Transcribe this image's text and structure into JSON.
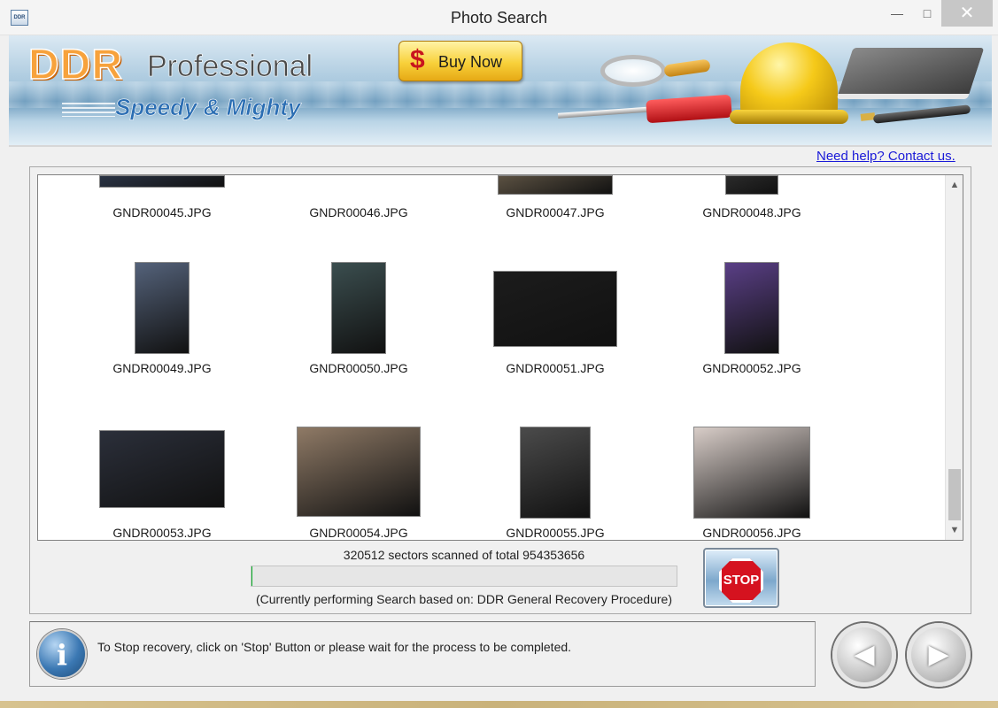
{
  "window": {
    "title": "Photo Search",
    "icon_text": "DDR",
    "minimize_icon": "minimize-icon",
    "maximize_icon": "maximize-icon",
    "close_icon": "close-icon"
  },
  "banner": {
    "brand": "DDR",
    "product": "Professional",
    "tagline": "Speedy & Mighty",
    "buy_symbol": "$",
    "buy_label": "Buy Now"
  },
  "help_link": "Need help? Contact us.",
  "gallery": {
    "items": [
      {
        "name": "GNDR00045.JPG",
        "color": "#2a3344"
      },
      {
        "name": "GNDR00046.JPG",
        "color": "#ffffff"
      },
      {
        "name": "GNDR00047.JPG",
        "color": "#5b5142"
      },
      {
        "name": "GNDR00048.JPG",
        "color": "#2b2b2b"
      },
      {
        "name": "GNDR00049.JPG",
        "color": "#54627a"
      },
      {
        "name": "GNDR00050.JPG",
        "color": "#3b4e4f"
      },
      {
        "name": "GNDR00051.JPG",
        "color": "#1c1c1c"
      },
      {
        "name": "GNDR00052.JPG",
        "color": "#5a3f86"
      },
      {
        "name": "GNDR00053.JPG",
        "color": "#2b2f3a"
      },
      {
        "name": "GNDR00054.JPG",
        "color": "#8f7a66"
      },
      {
        "name": "GNDR00055.JPG",
        "color": "#4b4b4b"
      },
      {
        "name": "GNDR00056.JPG",
        "color": "#d8cdc8"
      }
    ]
  },
  "progress": {
    "text": "320512 sectors scanned of total 954353656",
    "sectors_scanned": 320512,
    "sectors_total": 954353656,
    "procedure": "(Currently performing Search based on:  DDR General Recovery Procedure)"
  },
  "stop_button": {
    "label": "STOP"
  },
  "info": {
    "icon": "info-icon",
    "glyph": "i",
    "message": "To Stop recovery, click on 'Stop' Button or please wait for the process to be completed."
  },
  "nav": {
    "back_glyph": "◀",
    "next_glyph": "▶"
  },
  "colors": {
    "progress_fill": "#06b025",
    "link": "#1a1ad8",
    "accent": "#f7a23c"
  }
}
